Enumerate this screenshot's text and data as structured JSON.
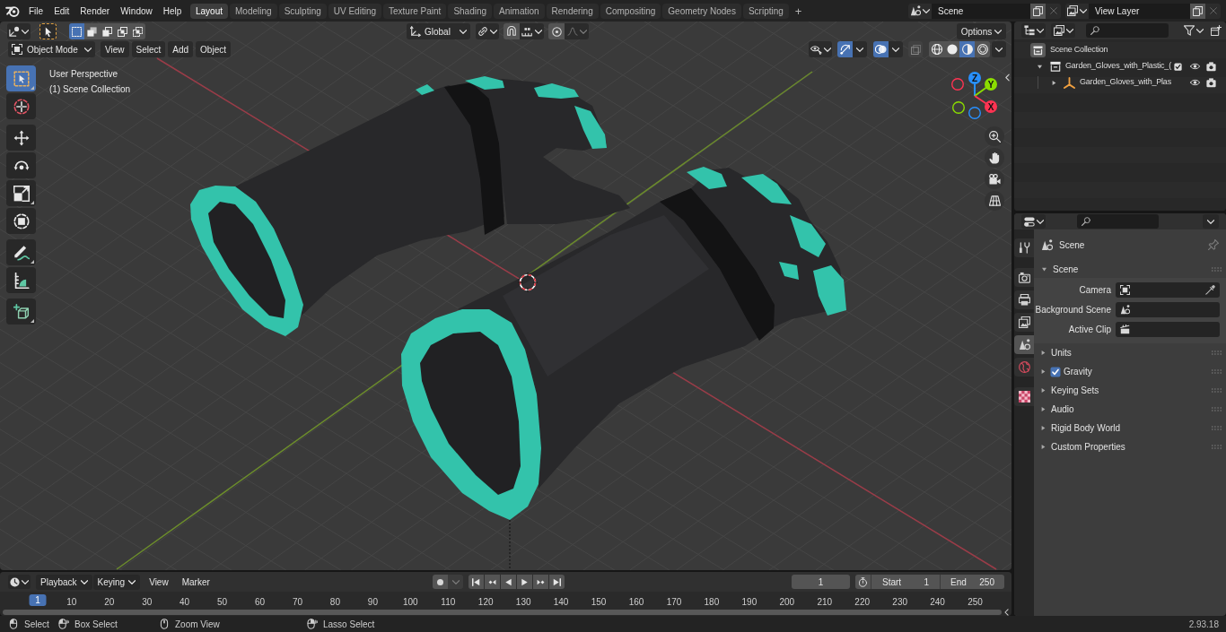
{
  "top_bar": {
    "menus": [
      "File",
      "Edit",
      "Render",
      "Window",
      "Help"
    ],
    "workspaces": [
      {
        "label": "Layout",
        "selected": true
      },
      {
        "label": "Modeling",
        "selected": false
      },
      {
        "label": "Sculpting",
        "selected": false
      },
      {
        "label": "UV Editing",
        "selected": false
      },
      {
        "label": "Texture Paint",
        "selected": false
      },
      {
        "label": "Shading",
        "selected": false
      },
      {
        "label": "Animation",
        "selected": false
      },
      {
        "label": "Rendering",
        "selected": false
      },
      {
        "label": "Compositing",
        "selected": false
      },
      {
        "label": "Geometry Nodes",
        "selected": false
      },
      {
        "label": "Scripting",
        "selected": false
      }
    ],
    "add_workspace": "+",
    "scene": "Scene",
    "view_layer": "View Layer"
  },
  "viewport": {
    "header": {
      "select_modes": [
        {
          "kind": "set",
          "selected": true
        },
        {
          "kind": "extend",
          "selected": false
        },
        {
          "kind": "subtract",
          "selected": false
        },
        {
          "kind": "difference",
          "selected": false
        },
        {
          "kind": "intersect",
          "selected": false
        }
      ],
      "orientation": "Global",
      "options": "Options",
      "mode": "Object Mode",
      "menus": [
        "View",
        "Select",
        "Add",
        "Object"
      ],
      "gizmos_on": true,
      "overlays_on": true,
      "xray_on": false,
      "shading": [
        {
          "kind": "wireframe",
          "selected": false
        },
        {
          "kind": "solid",
          "selected": false
        },
        {
          "kind": "material",
          "selected": true
        },
        {
          "kind": "rendered",
          "selected": false
        }
      ]
    },
    "toolbar": [
      [
        {
          "kind": "select_box",
          "selected": true,
          "submenu": true
        },
        {
          "kind": "cursor",
          "selected": false,
          "submenu": false
        }
      ],
      [
        {
          "kind": "move",
          "selected": false,
          "submenu": false
        },
        {
          "kind": "rotate",
          "selected": false,
          "submenu": false
        },
        {
          "kind": "scale",
          "selected": false,
          "submenu": true
        },
        {
          "kind": "transform",
          "selected": false,
          "submenu": false
        }
      ],
      [
        {
          "kind": "annotate",
          "selected": false,
          "submenu": true
        },
        {
          "kind": "measure",
          "selected": false,
          "submenu": false
        }
      ],
      [
        {
          "kind": "add_cube",
          "selected": false,
          "submenu": true
        }
      ]
    ],
    "info": [
      "User Perspective",
      "(1) Scene Collection"
    ],
    "navigation_gizmo": [
      {
        "label": "Z",
        "color": "#2890ff"
      },
      {
        "label": "Y",
        "color": "#8bdc00"
      },
      {
        "label": "X",
        "color": "#ff3352"
      }
    ]
  },
  "outliner": {
    "tree": [
      {
        "label": "Scene Collection",
        "kind": "scene_collection",
        "children": [
          {
            "label": "Garden_Gloves_with_Plastic_(",
            "kind": "collection",
            "expanded": true,
            "checked": true,
            "visible": true,
            "renderable": true,
            "children": [
              {
                "label": "Garden_Gloves_with_Plas",
                "kind": "empty",
                "expanded": false,
                "visible": true,
                "renderable": true
              }
            ]
          }
        ]
      }
    ]
  },
  "properties": {
    "tabs": [
      [
        {
          "kind": "tool",
          "selected": false
        }
      ],
      [
        {
          "kind": "render",
          "selected": false
        },
        {
          "kind": "output",
          "selected": false
        },
        {
          "kind": "view_layer",
          "selected": false
        },
        {
          "kind": "scene",
          "selected": true
        },
        {
          "kind": "world",
          "selected": false
        }
      ],
      [
        {
          "kind": "texture",
          "selected": false
        }
      ]
    ],
    "context": "Scene",
    "panels": [
      {
        "title": "Scene",
        "kind": "plain",
        "expanded": true,
        "fields": [
          {
            "label": "Camera",
            "kind": "camera"
          },
          {
            "label": "Background Scene",
            "kind": "scene"
          },
          {
            "label": "Active Clip",
            "kind": "clip"
          }
        ]
      },
      {
        "title": "Units",
        "kind": "plain",
        "expanded": false
      },
      {
        "title": "Gravity",
        "kind": "checkbox",
        "expanded": false,
        "checked": true
      },
      {
        "title": "Keying Sets",
        "kind": "plain",
        "expanded": false
      },
      {
        "title": "Audio",
        "kind": "plain",
        "expanded": false
      },
      {
        "title": "Rigid Body World",
        "kind": "plain",
        "expanded": false
      },
      {
        "title": "Custom Properties",
        "kind": "plain",
        "expanded": false
      }
    ]
  },
  "timeline": {
    "menus": [
      {
        "label": "Playback",
        "kind": "dropdown"
      },
      {
        "label": "Keying",
        "kind": "dropdown"
      },
      {
        "label": "View",
        "kind": "menu"
      },
      {
        "label": "Marker",
        "kind": "menu"
      }
    ],
    "auto_keying": false,
    "current_frame": "1",
    "start": {
      "label": "Start",
      "value": "1"
    },
    "end": {
      "label": "End",
      "value": "250"
    },
    "ruler": {
      "current": "1",
      "labels": [
        "10",
        "20",
        "30",
        "40",
        "50",
        "60",
        "70",
        "80",
        "90",
        "100",
        "110",
        "120",
        "130",
        "140",
        "150",
        "160",
        "170",
        "180",
        "190",
        "200",
        "210",
        "220",
        "230",
        "240",
        "250"
      ]
    }
  },
  "status_bar": {
    "hints": [
      {
        "kind": "left_click",
        "label": "Select"
      },
      {
        "kind": "left_drag",
        "label": "Box Select"
      },
      {
        "kind": "middle_click",
        "label": "Zoom View"
      },
      {
        "kind": "right_drag",
        "label": "Lasso Select"
      }
    ],
    "version": "2.93.18"
  }
}
